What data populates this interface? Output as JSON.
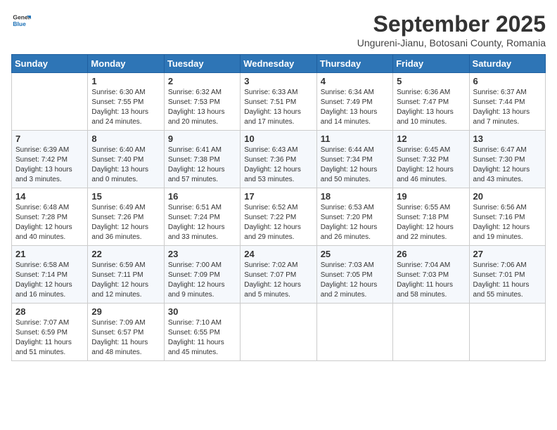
{
  "header": {
    "logo": {
      "general": "General",
      "blue": "Blue"
    },
    "title": "September 2025",
    "subtitle": "Ungureni-Jianu, Botosani County, Romania"
  },
  "calendar": {
    "days_of_week": [
      "Sunday",
      "Monday",
      "Tuesday",
      "Wednesday",
      "Thursday",
      "Friday",
      "Saturday"
    ],
    "weeks": [
      [
        {
          "day": "",
          "sunrise": "",
          "sunset": "",
          "daylight": ""
        },
        {
          "day": "1",
          "sunrise": "Sunrise: 6:30 AM",
          "sunset": "Sunset: 7:55 PM",
          "daylight": "Daylight: 13 hours and 24 minutes."
        },
        {
          "day": "2",
          "sunrise": "Sunrise: 6:32 AM",
          "sunset": "Sunset: 7:53 PM",
          "daylight": "Daylight: 13 hours and 20 minutes."
        },
        {
          "day": "3",
          "sunrise": "Sunrise: 6:33 AM",
          "sunset": "Sunset: 7:51 PM",
          "daylight": "Daylight: 13 hours and 17 minutes."
        },
        {
          "day": "4",
          "sunrise": "Sunrise: 6:34 AM",
          "sunset": "Sunset: 7:49 PM",
          "daylight": "Daylight: 13 hours and 14 minutes."
        },
        {
          "day": "5",
          "sunrise": "Sunrise: 6:36 AM",
          "sunset": "Sunset: 7:47 PM",
          "daylight": "Daylight: 13 hours and 10 minutes."
        },
        {
          "day": "6",
          "sunrise": "Sunrise: 6:37 AM",
          "sunset": "Sunset: 7:44 PM",
          "daylight": "Daylight: 13 hours and 7 minutes."
        }
      ],
      [
        {
          "day": "7",
          "sunrise": "Sunrise: 6:39 AM",
          "sunset": "Sunset: 7:42 PM",
          "daylight": "Daylight: 13 hours and 3 minutes."
        },
        {
          "day": "8",
          "sunrise": "Sunrise: 6:40 AM",
          "sunset": "Sunset: 7:40 PM",
          "daylight": "Daylight: 13 hours and 0 minutes."
        },
        {
          "day": "9",
          "sunrise": "Sunrise: 6:41 AM",
          "sunset": "Sunset: 7:38 PM",
          "daylight": "Daylight: 12 hours and 57 minutes."
        },
        {
          "day": "10",
          "sunrise": "Sunrise: 6:43 AM",
          "sunset": "Sunset: 7:36 PM",
          "daylight": "Daylight: 12 hours and 53 minutes."
        },
        {
          "day": "11",
          "sunrise": "Sunrise: 6:44 AM",
          "sunset": "Sunset: 7:34 PM",
          "daylight": "Daylight: 12 hours and 50 minutes."
        },
        {
          "day": "12",
          "sunrise": "Sunrise: 6:45 AM",
          "sunset": "Sunset: 7:32 PM",
          "daylight": "Daylight: 12 hours and 46 minutes."
        },
        {
          "day": "13",
          "sunrise": "Sunrise: 6:47 AM",
          "sunset": "Sunset: 7:30 PM",
          "daylight": "Daylight: 12 hours and 43 minutes."
        }
      ],
      [
        {
          "day": "14",
          "sunrise": "Sunrise: 6:48 AM",
          "sunset": "Sunset: 7:28 PM",
          "daylight": "Daylight: 12 hours and 40 minutes."
        },
        {
          "day": "15",
          "sunrise": "Sunrise: 6:49 AM",
          "sunset": "Sunset: 7:26 PM",
          "daylight": "Daylight: 12 hours and 36 minutes."
        },
        {
          "day": "16",
          "sunrise": "Sunrise: 6:51 AM",
          "sunset": "Sunset: 7:24 PM",
          "daylight": "Daylight: 12 hours and 33 minutes."
        },
        {
          "day": "17",
          "sunrise": "Sunrise: 6:52 AM",
          "sunset": "Sunset: 7:22 PM",
          "daylight": "Daylight: 12 hours and 29 minutes."
        },
        {
          "day": "18",
          "sunrise": "Sunrise: 6:53 AM",
          "sunset": "Sunset: 7:20 PM",
          "daylight": "Daylight: 12 hours and 26 minutes."
        },
        {
          "day": "19",
          "sunrise": "Sunrise: 6:55 AM",
          "sunset": "Sunset: 7:18 PM",
          "daylight": "Daylight: 12 hours and 22 minutes."
        },
        {
          "day": "20",
          "sunrise": "Sunrise: 6:56 AM",
          "sunset": "Sunset: 7:16 PM",
          "daylight": "Daylight: 12 hours and 19 minutes."
        }
      ],
      [
        {
          "day": "21",
          "sunrise": "Sunrise: 6:58 AM",
          "sunset": "Sunset: 7:14 PM",
          "daylight": "Daylight: 12 hours and 16 minutes."
        },
        {
          "day": "22",
          "sunrise": "Sunrise: 6:59 AM",
          "sunset": "Sunset: 7:11 PM",
          "daylight": "Daylight: 12 hours and 12 minutes."
        },
        {
          "day": "23",
          "sunrise": "Sunrise: 7:00 AM",
          "sunset": "Sunset: 7:09 PM",
          "daylight": "Daylight: 12 hours and 9 minutes."
        },
        {
          "day": "24",
          "sunrise": "Sunrise: 7:02 AM",
          "sunset": "Sunset: 7:07 PM",
          "daylight": "Daylight: 12 hours and 5 minutes."
        },
        {
          "day": "25",
          "sunrise": "Sunrise: 7:03 AM",
          "sunset": "Sunset: 7:05 PM",
          "daylight": "Daylight: 12 hours and 2 minutes."
        },
        {
          "day": "26",
          "sunrise": "Sunrise: 7:04 AM",
          "sunset": "Sunset: 7:03 PM",
          "daylight": "Daylight: 11 hours and 58 minutes."
        },
        {
          "day": "27",
          "sunrise": "Sunrise: 7:06 AM",
          "sunset": "Sunset: 7:01 PM",
          "daylight": "Daylight: 11 hours and 55 minutes."
        }
      ],
      [
        {
          "day": "28",
          "sunrise": "Sunrise: 7:07 AM",
          "sunset": "Sunset: 6:59 PM",
          "daylight": "Daylight: 11 hours and 51 minutes."
        },
        {
          "day": "29",
          "sunrise": "Sunrise: 7:09 AM",
          "sunset": "Sunset: 6:57 PM",
          "daylight": "Daylight: 11 hours and 48 minutes."
        },
        {
          "day": "30",
          "sunrise": "Sunrise: 7:10 AM",
          "sunset": "Sunset: 6:55 PM",
          "daylight": "Daylight: 11 hours and 45 minutes."
        },
        {
          "day": "",
          "sunrise": "",
          "sunset": "",
          "daylight": ""
        },
        {
          "day": "",
          "sunrise": "",
          "sunset": "",
          "daylight": ""
        },
        {
          "day": "",
          "sunrise": "",
          "sunset": "",
          "daylight": ""
        },
        {
          "day": "",
          "sunrise": "",
          "sunset": "",
          "daylight": ""
        }
      ]
    ]
  }
}
